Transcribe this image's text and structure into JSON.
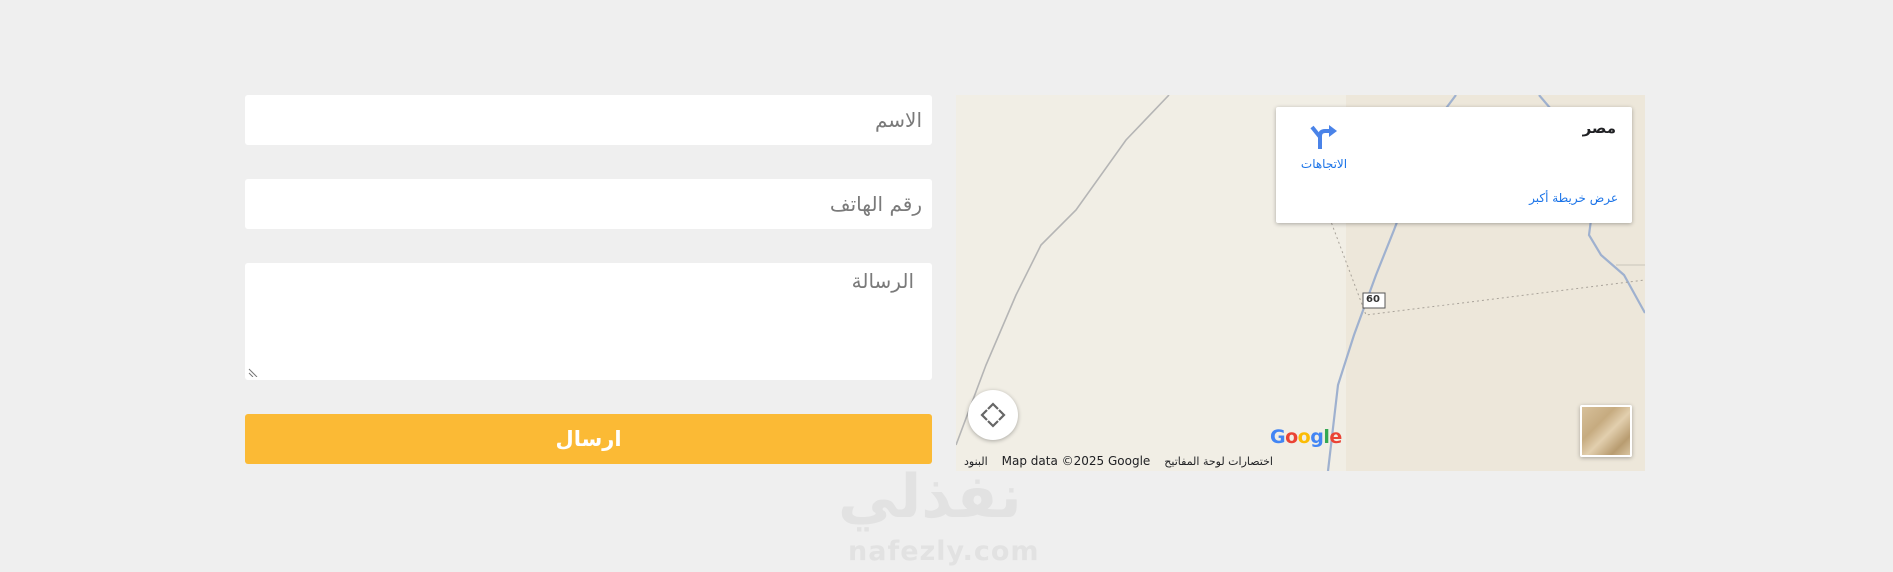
{
  "form": {
    "name_placeholder": "الاسم",
    "phone_placeholder": "رقم الهاتف",
    "message_placeholder": "الرسالة",
    "submit_label": "ارسال",
    "accent_color": "#fbba35"
  },
  "map": {
    "place_name": "مصر",
    "directions_label": "الاتجاهات",
    "view_larger_map": "عرض خريطة أكبر",
    "road_shield": "60",
    "google_logo": "Google",
    "attribution": {
      "terms": "البنود",
      "map_data": "Map data ©2025 Google",
      "keyboard_shortcuts": "اختصارات لوحة المفاتيح"
    },
    "icons": [
      "directions-icon",
      "pan-control-icon",
      "satellite-layer-thumbnail"
    ]
  },
  "watermark": {
    "arabic": "نفذلي",
    "latin": "nafezly.com"
  }
}
